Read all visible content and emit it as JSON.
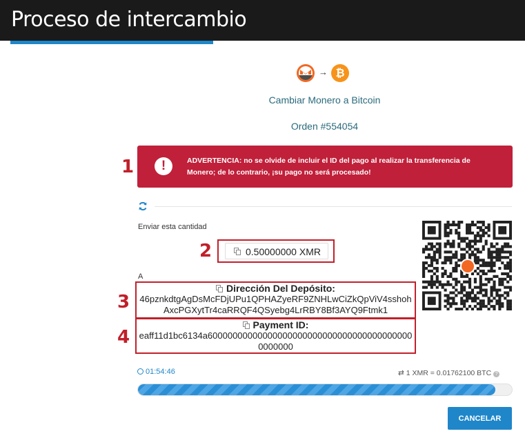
{
  "header": {
    "title": "Proceso de intercambio"
  },
  "pair": {
    "from_icon": "monero-icon",
    "to_icon": "bitcoin-icon",
    "arrow": "→",
    "btc_glyph": "₿"
  },
  "exchange": {
    "title": "Cambiar Monero a Bitcoin",
    "order": "Orden #554054"
  },
  "warning": {
    "text": "ADVERTENCIA: no se olvide de incluir el ID del pago al realizar la transferencia de Monero; de lo contrario, ¡su pago no será procesado!",
    "icon": "!"
  },
  "markers": [
    "1",
    "2",
    "3",
    "4"
  ],
  "send": {
    "label": "Enviar esta cantidad",
    "amount": "0.50000000 XMR"
  },
  "to_label": "A",
  "deposit": {
    "heading": "Dirección Del Depósito:",
    "address": "46pznkdtgAgDsMcFDjUPu1QPHAZyeRF9ZNHLwCiZkQpViV4sshohAxcPGXytTr4caRRQF4QSyebg4LrRBY8Bf3AYQ9Ftmk1"
  },
  "payment": {
    "heading": "Payment ID:",
    "id": "eaff11d1bc6134a600000000000000000000000000000000000000000000000"
  },
  "timer": {
    "value": "01:54:46"
  },
  "rate": {
    "text": "⇄  1 XMR = 0.01762100 BTC",
    "info": "?"
  },
  "progress": {
    "fraction": 0.955
  },
  "buttons": {
    "cancel": "CANCELAR"
  },
  "colors": {
    "accent": "#1f86c9",
    "warning": "#c0203a",
    "monero": "#f26822",
    "bitcoin": "#f7931a"
  }
}
